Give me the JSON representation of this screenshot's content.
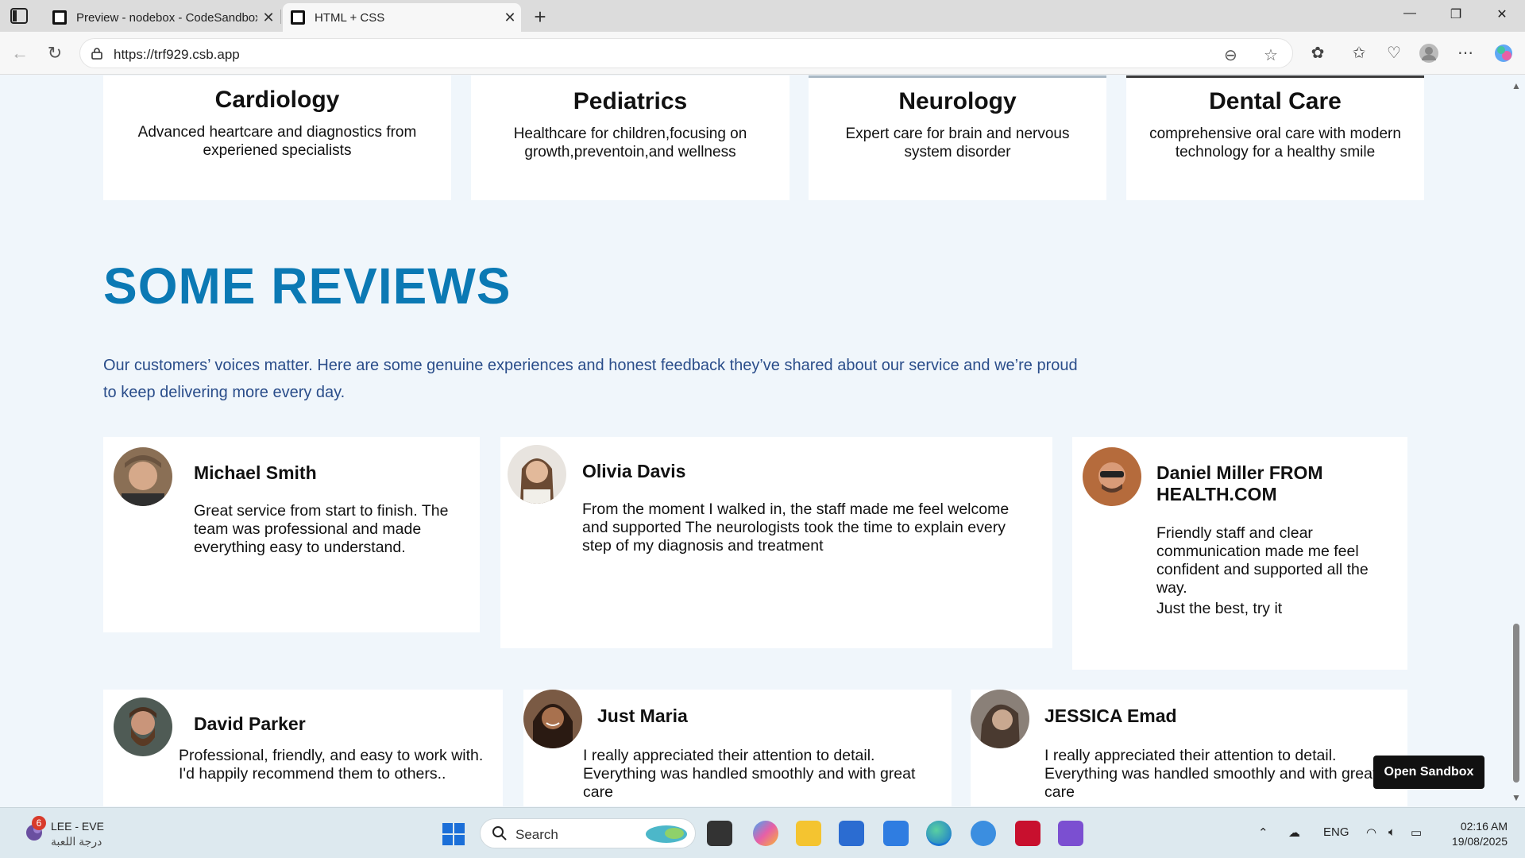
{
  "browser": {
    "tabs": [
      {
        "title": "Preview - nodebox - CodeSandbox",
        "active": false
      },
      {
        "title": "HTML + CSS",
        "active": true
      }
    ],
    "url": "https://trf929.csb.app"
  },
  "services": [
    {
      "title": "Cardiology",
      "desc": "Advanced heartcare and diagnostics from experiened specialists"
    },
    {
      "title": "Pediatrics",
      "desc": "Healthcare for children,focusing on growth,preventoin,and wellness"
    },
    {
      "title": "Neurology",
      "desc": "Expert care for brain and nervous system disorder"
    },
    {
      "title": "Dental Care",
      "desc": "comprehensive oral care with modern technology for a healthy smile"
    }
  ],
  "reviews_section": {
    "title": "SOME REVIEWS",
    "intro": "Our customers’ voices matter. Here are some genuine experiences and honest feedback they’ve shared about our service and we’re proud to keep delivering more every day."
  },
  "reviews": [
    {
      "name": "Michael Smith",
      "text": "Great service from start to finish. The team was professional and made everything easy to understand."
    },
    {
      "name": "Olivia Davis",
      "text": "From the moment I walked in, the staff made me feel welcome and supported The neurologists took the time to explain every step of my diagnosis and treatment"
    },
    {
      "name": "Daniel Miller FROM HEALTH.COM",
      "text": "Friendly staff and clear communication made me feel confident and supported all the way.",
      "text2": "Just the best, try it"
    },
    {
      "name": "David Parker",
      "text": "Professional, friendly, and easy to work with. I'd happily recommend them to others.."
    },
    {
      "name": "Just Maria",
      "text": "I really appreciated their attention to detail. Everything was handled smoothly and with great care"
    },
    {
      "name": "JESSICA Emad",
      "text": "I really appreciated their attention to detail. Everything was handled smoothly and with great care"
    }
  ],
  "open_sandbox_label": "Open Sandbox",
  "taskbar": {
    "weather_badge": "6",
    "weather_title": "LEE - EVE",
    "weather_sub": "درجة اللعبة",
    "search_label": "Search",
    "language": "ENG",
    "time": "02:16 AM",
    "date": "19/08/2025"
  },
  "colors": {
    "accent_title": "#0b79b4",
    "intro_text": "#2a4d8a",
    "page_bg": "#f0f6fb"
  }
}
